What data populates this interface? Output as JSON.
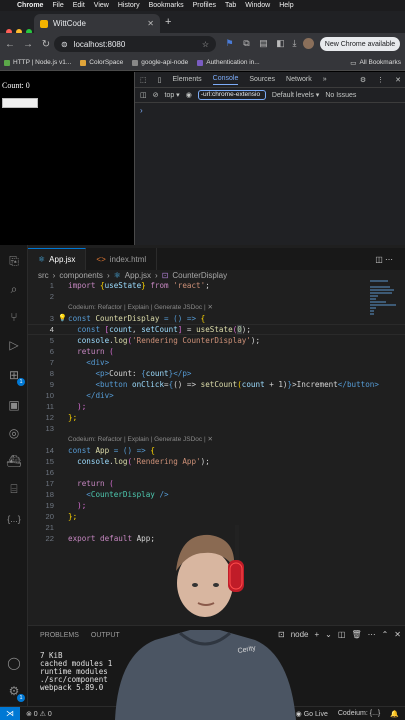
{
  "menubar": {
    "app": "Chrome",
    "items": [
      "File",
      "Edit",
      "View",
      "History",
      "Bookmarks",
      "Profiles",
      "Tab",
      "Window",
      "Help"
    ]
  },
  "browser": {
    "tab_title": "WittCode",
    "address": "localhost:8080",
    "update_button": "New Chrome available",
    "bookmarks": [
      "HTTP | Node.js v1...",
      "ColorSpace",
      "google-api-node",
      "Authentication in..."
    ],
    "all_bookmarks": "All Bookmarks"
  },
  "page": {
    "count_text": "Count: 0",
    "button_label": ""
  },
  "devtools": {
    "tabs": [
      "Elements",
      "Console",
      "Sources",
      "Network"
    ],
    "active_tab": "Console",
    "context": "top",
    "filter_value": "-url:chrome-extensio",
    "levels": "Default levels",
    "issues": "No Issues",
    "prompt": "›"
  },
  "vscode": {
    "tabs": [
      {
        "label": "App.jsx",
        "active": true
      },
      {
        "label": "index.html",
        "active": false
      }
    ],
    "breadcrumb": [
      "src",
      "components",
      "App.jsx",
      "CounterDisplay"
    ],
    "codelens": "Codeium: Refactor | Explain | Generate JSDoc | ✕",
    "line_numbers": [
      "1",
      "2",
      "3",
      "4",
      "5",
      "6",
      "7",
      "8",
      "9",
      "10",
      "11",
      "12",
      "13",
      "14",
      "15",
      "16",
      "17",
      "18",
      "19",
      "20",
      "21",
      "22"
    ],
    "code": {
      "l1": [
        "import ",
        "{",
        "useState",
        "}",
        " from ",
        "'react'",
        ";"
      ],
      "l3": [
        "const ",
        "CounterDisplay",
        " = () => ",
        "{"
      ],
      "l4": [
        "const ",
        "[",
        "count",
        ", ",
        "setCount",
        "]",
        " = ",
        "useState",
        "(",
        "0",
        ");"
      ],
      "l5": [
        "console",
        ".",
        "log",
        "(",
        "'Rendering CounterDisplay'",
        ");"
      ],
      "l6": [
        "return",
        " ("
      ],
      "l7": [
        "<div>"
      ],
      "l8": [
        "<p>",
        "Count: ",
        "{",
        "count",
        "}",
        "</p>"
      ],
      "l9": [
        "<button ",
        "onClick",
        "=",
        "{",
        "() => ",
        "setCount",
        "(",
        "count",
        " + 1)",
        "}",
        ">Increment",
        "</button>"
      ],
      "l10": [
        "</div>"
      ],
      "l11": [
        ");"
      ],
      "l12": [
        "};"
      ],
      "l14": [
        "const ",
        "App",
        " = () => ",
        "{"
      ],
      "l15": [
        "console",
        ".",
        "log",
        "(",
        "'Rendering App'",
        ");"
      ],
      "l17": [
        "return",
        " ("
      ],
      "l18": [
        "<",
        "CounterDisplay",
        " />"
      ],
      "l19": [
        ");"
      ],
      "l20": [
        "};"
      ],
      "l22": [
        "export ",
        "default ",
        "App",
        ";"
      ]
    },
    "panel": {
      "tabs": [
        "PROBLEMS",
        "OUTPUT"
      ],
      "shell": "node",
      "terminal_lines": [
        "7 KiB",
        "cached modules 1",
        "runtime modules",
        "./src/component",
        "webpack 5.89.0"
      ]
    },
    "status": {
      "errors": "⊗ 0  ⚠ 0",
      "live": "Go Live",
      "codeium": "Codeium: {...}"
    }
  },
  "colors": {
    "accent": "#0078d4",
    "devtools_active": "#7cacf8"
  }
}
